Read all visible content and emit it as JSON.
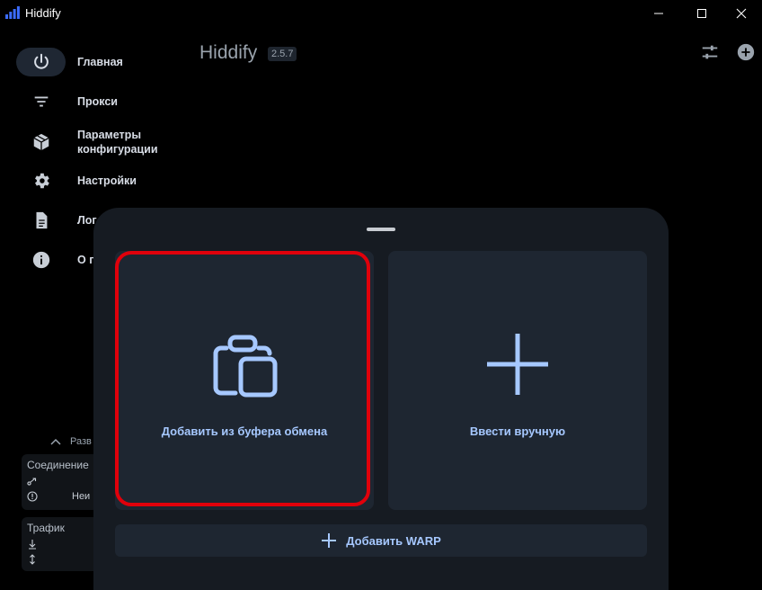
{
  "window": {
    "title": "Hiddify",
    "controls": [
      "minimize-icon",
      "maximize-icon",
      "close-icon"
    ]
  },
  "sidebar": {
    "items": [
      {
        "label": "Главная",
        "icon": "power-icon",
        "active": true
      },
      {
        "label": "Прокси",
        "icon": "filter-list-icon",
        "active": false
      },
      {
        "label": "Параметры\nконфигурации",
        "icon": "box-icon",
        "active": false
      },
      {
        "label": "Настройки",
        "icon": "gear-icon",
        "active": false
      },
      {
        "label": "Лог",
        "icon": "document-icon",
        "active": false
      },
      {
        "label": "О п",
        "icon": "info-icon",
        "active": false
      }
    ],
    "collapse_label": "Разв",
    "connection": {
      "title": "Соединение",
      "status": "Неи"
    },
    "traffic": {
      "title": "Трафик"
    }
  },
  "header": {
    "brand": "Hiddify",
    "version": "2.5.7",
    "icons": [
      "sliders-icon",
      "add-circle-icon"
    ]
  },
  "sheet": {
    "clipboard_label": "Добавить из буфера обмена",
    "manual_label": "Ввести вручную",
    "warp_label": "Добавить WARP"
  },
  "colors": {
    "background": "#000000",
    "sheet": "#161b22",
    "card": "#1e2631",
    "accent": "#a6c8ff",
    "highlight": "#e0000b"
  }
}
